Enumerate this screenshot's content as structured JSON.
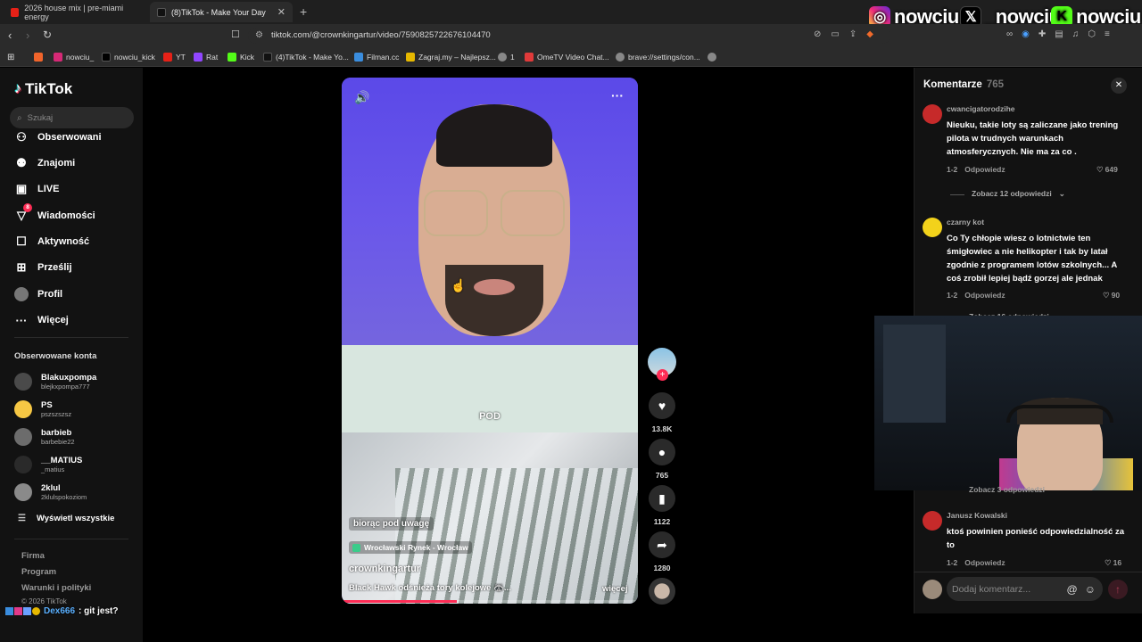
{
  "tabs": [
    {
      "label": "2026 house mix | pre-miami energy",
      "active": false,
      "icon": "youtube-icon",
      "color": "#e62117"
    },
    {
      "label": "(8)TikTok - Make Your Day",
      "active": true,
      "icon": "tiktok-icon",
      "color": "#000000"
    }
  ],
  "address": {
    "url": "tiktok.com/@crownkingartur/video/7590825722676104470"
  },
  "bookmarks": [
    {
      "label": "",
      "icon": "rss-icon",
      "color": "#f0642b"
    },
    {
      "label": "nowciu_",
      "icon": "instagram-icon",
      "color": "#d62976"
    },
    {
      "label": "nowciu_kick",
      "icon": "x-icon",
      "color": "#000000"
    },
    {
      "label": "YT",
      "icon": "youtube-icon",
      "color": "#e62117"
    },
    {
      "label": "Rat",
      "icon": "twitch-icon",
      "color": "#9146ff"
    },
    {
      "label": "Kick",
      "icon": "kick-icon",
      "color": "#53fc18"
    },
    {
      "label": "(4)TikTok - Make Yo...",
      "icon": "tiktok-icon",
      "color": "#111111"
    },
    {
      "label": "Filman.cc",
      "icon": "film-icon",
      "color": "#3a8dde"
    },
    {
      "label": "Zagraj.my – Najlepsz...",
      "icon": "game-icon",
      "color": "#e6b800"
    },
    {
      "label": "1",
      "icon": "globe-icon",
      "color": "#888888"
    },
    {
      "label": "OmeTV Video Chat...",
      "icon": "video-chat-icon",
      "color": "#e03a3a"
    },
    {
      "label": "brave://settings/con...",
      "icon": "globe-icon",
      "color": "#888888"
    },
    {
      "label": "",
      "icon": "globe-icon",
      "color": "#888888"
    }
  ],
  "overlay": {
    "handles": [
      {
        "label": "nowciu_",
        "icon": "instagram-icon",
        "color": "#d62976"
      },
      {
        "label": "_nowciu",
        "icon": "x-icon",
        "color": "#000000"
      },
      {
        "label": "nowciu",
        "icon": "kick-icon",
        "color": "#53fc18"
      }
    ],
    "chat": {
      "user": "Dex666",
      "message": ": git jest?"
    }
  },
  "sidebar": {
    "logo": "TikTok",
    "search_placeholder": "Szukaj",
    "nav": [
      {
        "label": "Obserwowani",
        "icon": "following-icon"
      },
      {
        "label": "Znajomi",
        "icon": "friends-icon"
      },
      {
        "label": "LIVE",
        "icon": "live-icon"
      },
      {
        "label": "Wiadomości",
        "icon": "messages-icon",
        "badge": "8"
      },
      {
        "label": "Aktywność",
        "icon": "activity-icon"
      },
      {
        "label": "Prześlij",
        "icon": "upload-icon"
      },
      {
        "label": "Profil",
        "icon": "profile-icon"
      },
      {
        "label": "Więcej",
        "icon": "more-icon"
      }
    ],
    "followed_header": "Obserwowane konta",
    "accounts": [
      {
        "name": "Blakuxpompa",
        "handle": "blejkxpompa777"
      },
      {
        "name": "PS",
        "handle": "pszszszsz"
      },
      {
        "name": "barbieb",
        "handle": "barbebie22"
      },
      {
        "name": "__MATIUS",
        "handle": "_matius"
      },
      {
        "name": "2klul",
        "handle": "2klulspokoziom"
      }
    ],
    "show_all": "Wyświetl wszystkie",
    "footer": [
      "Firma",
      "Program",
      "Warunki i polityki",
      "© 2026 TikTok"
    ]
  },
  "video": {
    "caption_word": "POD",
    "subtitle": "biorąc pod uwagę",
    "location": "Wrocławski Rynek - Wrocław",
    "author": "crownkingartur",
    "description": "Black Hawk odśnieża tory kolejowe 🦝...",
    "more": "więcej",
    "progress": 0.39
  },
  "actions": {
    "likes": "13.8K",
    "comments": "765",
    "saves": "1122",
    "shares": "1280"
  },
  "comments": {
    "title": "Komentarze",
    "count": "765",
    "reply_label": "Odpowiedz",
    "items": [
      {
        "user": "cwancigatorodzihe",
        "text": "Nieuku, takie loty są zaliczane jako trening pilota w trudnych warunkach atmosferycznych. Nie ma za co .",
        "date": "1-2",
        "likes": "649",
        "replies": "Zobacz 12 odpowiedzi"
      },
      {
        "user": "czarny kot",
        "text": "Co Ty chłopie wiesz o lotnictwie ten śmigłowiec a nie helikopter i tak by latał zgodnie z programem lotów szkolnych... A coś zrobił lepiej bądź gorzej ale jednak",
        "date": "1-2",
        "likes": "90",
        "replies": "Zobacz 16 odpowiedzi"
      },
      {
        "user": "Janusz Kowalski",
        "text": "ktoś powinien ponieść odpowiedzialność za to",
        "date": "1-2",
        "likes": "16",
        "replies": ""
      }
    ],
    "hidden_reply": "Zobacz 3 odpowiedzi",
    "input_placeholder": "Dodaj komentarz...",
    "colors": {
      "accent": "#fe2c55"
    }
  }
}
